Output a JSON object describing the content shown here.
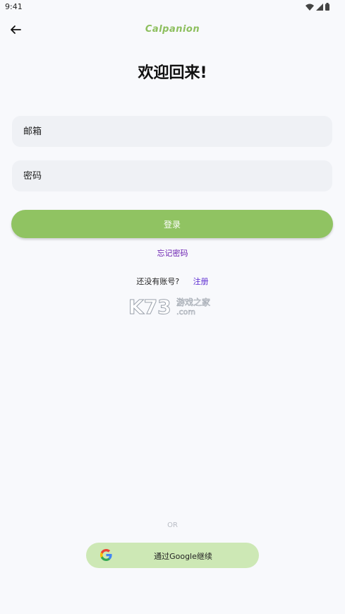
{
  "status": {
    "time": "9:41"
  },
  "header": {
    "logo": "Calpanion"
  },
  "main": {
    "title": "欢迎回来!",
    "email_placeholder": "邮箱",
    "password_placeholder": "密码",
    "login_label": "登录",
    "forgot_label": "忘记密码",
    "no_account_text": "还没有账号?",
    "register_label": "注册"
  },
  "watermark": {
    "text": "K73",
    "sub_text": "游戏之家",
    "domain": ".com"
  },
  "footer": {
    "or_text": "OR",
    "google_label": "通过Google继续"
  },
  "colors": {
    "accent": "#90c362",
    "google_button": "#cde8b5",
    "link": "#5b2ad1"
  },
  "icons": {
    "back": "arrow-left-icon",
    "wifi": "wifi-icon",
    "signal": "signal-icon",
    "battery": "battery-icon",
    "google": "google-g-icon"
  }
}
